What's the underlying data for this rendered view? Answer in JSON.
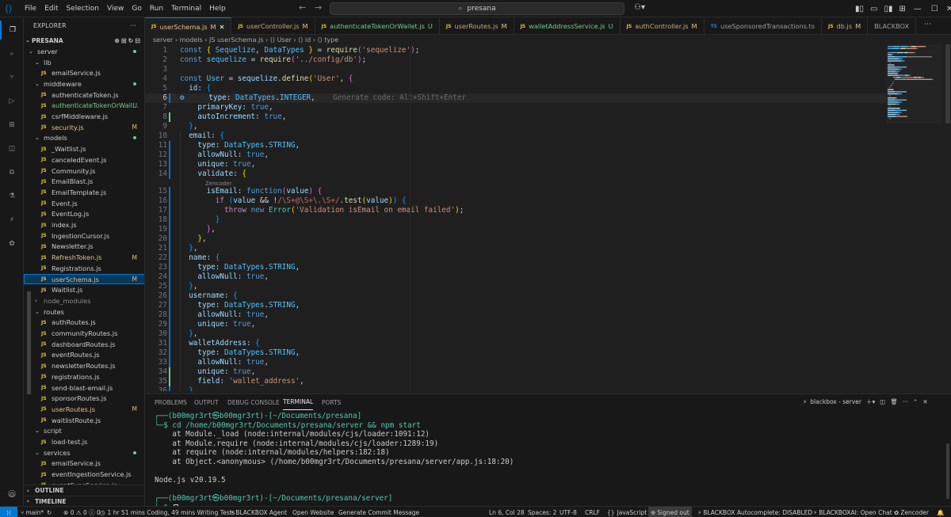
{
  "menu": [
    "File",
    "Edit",
    "Selection",
    "View",
    "Go",
    "Run",
    "Terminal",
    "Help"
  ],
  "search": "presana",
  "explorer": {
    "title": "EXPLORER",
    "root": "PRESANA",
    "rows": [
      {
        "label": "server",
        "type": "folder",
        "depth": 1,
        "status": "dot"
      },
      {
        "label": "lib",
        "type": "folder",
        "depth": 2,
        "status": ""
      },
      {
        "label": "emailService.js",
        "type": "file",
        "depth": 3,
        "status": ""
      },
      {
        "label": "middleware",
        "type": "folder",
        "depth": 2,
        "status": "dot"
      },
      {
        "label": "authenticateToken.js",
        "type": "file",
        "depth": 3,
        "status": ""
      },
      {
        "label": "authenticateTokenOrWall...",
        "type": "file",
        "depth": 3,
        "status": "U"
      },
      {
        "label": "csrfMiddleware.js",
        "type": "file",
        "depth": 3,
        "status": ""
      },
      {
        "label": "security.js",
        "type": "file",
        "depth": 3,
        "status": "M"
      },
      {
        "label": "models",
        "type": "folder",
        "depth": 2,
        "status": "dot"
      },
      {
        "label": "_Waitlist.js",
        "type": "file",
        "depth": 3,
        "status": ""
      },
      {
        "label": "canceledEvent.js",
        "type": "file",
        "depth": 3,
        "status": ""
      },
      {
        "label": "Community.js",
        "type": "file",
        "depth": 3,
        "status": ""
      },
      {
        "label": "EmailBlast.js",
        "type": "file",
        "depth": 3,
        "status": ""
      },
      {
        "label": "EmailTemplate.js",
        "type": "file",
        "depth": 3,
        "status": ""
      },
      {
        "label": "Event.js",
        "type": "file",
        "depth": 3,
        "status": ""
      },
      {
        "label": "EventLog.js",
        "type": "file",
        "depth": 3,
        "status": ""
      },
      {
        "label": "index.js",
        "type": "file",
        "depth": 3,
        "status": ""
      },
      {
        "label": "IngestionCursor.js",
        "type": "file",
        "depth": 3,
        "status": ""
      },
      {
        "label": "Newsletter.js",
        "type": "file",
        "depth": 3,
        "status": ""
      },
      {
        "label": "RefreshToken.js",
        "type": "file",
        "depth": 3,
        "status": "M"
      },
      {
        "label": "Registrations.js",
        "type": "file",
        "depth": 3,
        "status": ""
      },
      {
        "label": "userSchema.js",
        "type": "file",
        "depth": 3,
        "status": "M",
        "selected": true
      },
      {
        "label": "Waitlist.js",
        "type": "file",
        "depth": 3,
        "status": ""
      },
      {
        "label": "node_modules",
        "type": "folder-closed",
        "depth": 2,
        "status": ""
      },
      {
        "label": "routes",
        "type": "folder",
        "depth": 2,
        "status": ""
      },
      {
        "label": "authRoutes.js",
        "type": "file",
        "depth": 3,
        "status": ""
      },
      {
        "label": "communityRoutes.js",
        "type": "file",
        "depth": 3,
        "status": ""
      },
      {
        "label": "dashboardRoutes.js",
        "type": "file",
        "depth": 3,
        "status": ""
      },
      {
        "label": "eventRoutes.js",
        "type": "file",
        "depth": 3,
        "status": ""
      },
      {
        "label": "newsletterRoutes.js",
        "type": "file",
        "depth": 3,
        "status": ""
      },
      {
        "label": "registrations.js",
        "type": "file",
        "depth": 3,
        "status": ""
      },
      {
        "label": "send-blast-email.js",
        "type": "file",
        "depth": 3,
        "status": ""
      },
      {
        "label": "sponsorRoutes.js",
        "type": "file",
        "depth": 3,
        "status": ""
      },
      {
        "label": "userRoutes.js",
        "type": "file",
        "depth": 3,
        "status": "M"
      },
      {
        "label": "waitlistRoute.js",
        "type": "file",
        "depth": 3,
        "status": ""
      },
      {
        "label": "script",
        "type": "folder",
        "depth": 2,
        "status": ""
      },
      {
        "label": "load-test.js",
        "type": "file",
        "depth": 3,
        "status": ""
      },
      {
        "label": "services",
        "type": "folder",
        "depth": 2,
        "status": "dot"
      },
      {
        "label": "emailService.js",
        "type": "file",
        "depth": 3,
        "status": ""
      },
      {
        "label": "eventIngestionService.js",
        "type": "file",
        "depth": 3,
        "status": ""
      },
      {
        "label": "eventSyncService.js",
        "type": "file",
        "depth": 3,
        "status": ""
      }
    ],
    "outline": "OUTLINE",
    "timeline": "TIMELINE"
  },
  "tabs": [
    {
      "label": "userSchema.js",
      "status": "M",
      "kind": "js",
      "active": true
    },
    {
      "label": "userController.js",
      "status": "M",
      "kind": "js"
    },
    {
      "label": "authenticateTokenOrWallet.js",
      "status": "U",
      "kind": "js"
    },
    {
      "label": "userRoutes.js",
      "status": "M",
      "kind": "js"
    },
    {
      "label": "walletAddressService.js",
      "status": "U",
      "kind": "js"
    },
    {
      "label": "authController.js",
      "status": "M",
      "kind": "js"
    },
    {
      "label": "useSponsoredTransactions.ts",
      "status": "",
      "kind": "ts"
    },
    {
      "label": "db.js",
      "status": "M",
      "kind": "js"
    },
    {
      "label": "BLACKBOX",
      "status": "",
      "kind": "none"
    }
  ],
  "breadcrumb": "server › models › JS userSchema.js › ⟨⟩ User › ⟨⟩ id › ⟨⟩ type",
  "code_lines": [
    [
      [
        "const ",
        "k"
      ],
      [
        "{ ",
        "b1"
      ],
      [
        "Sequelize",
        "v"
      ],
      [
        ", ",
        "pun"
      ],
      [
        "DataTypes",
        "v"
      ],
      [
        " } ",
        "b1"
      ],
      [
        "= ",
        "pun"
      ],
      [
        "require",
        "f"
      ],
      [
        "(",
        "b2"
      ],
      [
        "'sequelize'",
        "s"
      ],
      [
        ")",
        "b2"
      ],
      [
        ";",
        "pun"
      ]
    ],
    [
      [
        "const ",
        "k"
      ],
      [
        "sequelize ",
        "v"
      ],
      [
        "= ",
        "pun"
      ],
      [
        "require",
        "f"
      ],
      [
        "(",
        "b2"
      ],
      [
        "'../config/db'",
        "s"
      ],
      [
        ")",
        "b2"
      ],
      [
        ";",
        "pun"
      ]
    ],
    [],
    [
      [
        "const ",
        "k"
      ],
      [
        "User ",
        "v"
      ],
      [
        "= ",
        "pun"
      ],
      [
        "sequelize",
        "p"
      ],
      [
        ".",
        "pun"
      ],
      [
        "define",
        "f"
      ],
      [
        "(",
        "b1"
      ],
      [
        "'User'",
        "s"
      ],
      [
        ", ",
        "pun"
      ],
      [
        "{",
        "b2"
      ]
    ],
    [
      [
        "  id: ",
        "p"
      ],
      [
        "{",
        "b3"
      ]
    ],
    [
      [
        "    type: ",
        "p"
      ],
      [
        "DataTypes",
        "v"
      ],
      [
        ".",
        "pun"
      ],
      [
        "INTEGER",
        "v"
      ],
      [
        ",",
        "pun"
      ],
      [
        "    Generate code: Alt+Shift+Enter",
        "ghost"
      ]
    ],
    [
      [
        "    primaryKey: ",
        "p"
      ],
      [
        "true",
        "k"
      ],
      [
        ",",
        "pun"
      ]
    ],
    [
      [
        "    autoIncrement: ",
        "p"
      ],
      [
        "true",
        "k"
      ],
      [
        ",",
        "pun"
      ]
    ],
    [
      [
        "  ",
        "pun"
      ],
      [
        "}",
        "b3"
      ],
      [
        ",",
        "pun"
      ]
    ],
    [
      [
        "  email: ",
        "p"
      ],
      [
        "{",
        "b3"
      ]
    ],
    [
      [
        "    type: ",
        "p"
      ],
      [
        "DataTypes",
        "v"
      ],
      [
        ".",
        "pun"
      ],
      [
        "STRING",
        "v"
      ],
      [
        ",",
        "pun"
      ]
    ],
    [
      [
        "    allowNull: ",
        "p"
      ],
      [
        "true",
        "k"
      ],
      [
        ",",
        "pun"
      ]
    ],
    [
      [
        "    unique: ",
        "p"
      ],
      [
        "true",
        "k"
      ],
      [
        ",",
        "pun"
      ]
    ],
    [
      [
        "    validate: ",
        "p"
      ],
      [
        "{",
        "b1"
      ]
    ],
    [
      [
        "      isEmail: ",
        "p"
      ],
      [
        "function",
        "k"
      ],
      [
        "(",
        "b2"
      ],
      [
        "value",
        "p"
      ],
      [
        ") ",
        "b2"
      ],
      [
        "{",
        "b2"
      ]
    ],
    [
      [
        "        ",
        "pun"
      ],
      [
        "if ",
        "c"
      ],
      [
        "(",
        "b3"
      ],
      [
        "value ",
        "p"
      ],
      [
        "&& ",
        "pun"
      ],
      [
        "!",
        "pun"
      ],
      [
        "/\\S+@\\S+\\.\\S+/",
        "re"
      ],
      [
        ".",
        "pun"
      ],
      [
        "test",
        "f"
      ],
      [
        "(",
        "b1"
      ],
      [
        "value",
        "p"
      ],
      [
        ")",
        "b1"
      ],
      [
        ") ",
        "b3"
      ],
      [
        "{",
        "b3"
      ]
    ],
    [
      [
        "          ",
        "pun"
      ],
      [
        "throw ",
        "c"
      ],
      [
        "new ",
        "k"
      ],
      [
        "Error",
        "t"
      ],
      [
        "(",
        "b1"
      ],
      [
        "'Validation isEmail on email failed'",
        "s"
      ],
      [
        ")",
        "b1"
      ],
      [
        ";",
        "pun"
      ]
    ],
    [
      [
        "        ",
        "pun"
      ],
      [
        "}",
        "b3"
      ]
    ],
    [
      [
        "      ",
        "pun"
      ],
      [
        "}",
        "b2"
      ],
      [
        ",",
        "pun"
      ]
    ],
    [
      [
        "    ",
        "pun"
      ],
      [
        "}",
        "b1"
      ],
      [
        ",",
        "pun"
      ]
    ],
    [
      [
        "  ",
        "pun"
      ],
      [
        "}",
        "b3"
      ],
      [
        ",",
        "pun"
      ]
    ],
    [
      [
        "  name: ",
        "p"
      ],
      [
        "{",
        "b3"
      ]
    ],
    [
      [
        "    type: ",
        "p"
      ],
      [
        "DataTypes",
        "v"
      ],
      [
        ".",
        "pun"
      ],
      [
        "STRING",
        "v"
      ],
      [
        ",",
        "pun"
      ]
    ],
    [
      [
        "    allowNull: ",
        "p"
      ],
      [
        "true",
        "k"
      ],
      [
        ",",
        "pun"
      ]
    ],
    [
      [
        "  ",
        "pun"
      ],
      [
        "}",
        "b3"
      ],
      [
        ",",
        "pun"
      ]
    ],
    [
      [
        "  username: ",
        "p"
      ],
      [
        "{",
        "b3"
      ]
    ],
    [
      [
        "    type: ",
        "p"
      ],
      [
        "DataTypes",
        "v"
      ],
      [
        ".",
        "pun"
      ],
      [
        "STRING",
        "v"
      ],
      [
        ",",
        "pun"
      ]
    ],
    [
      [
        "    allowNull: ",
        "p"
      ],
      [
        "true",
        "k"
      ],
      [
        ",",
        "pun"
      ]
    ],
    [
      [
        "    unique: ",
        "p"
      ],
      [
        "true",
        "k"
      ],
      [
        ",",
        "pun"
      ]
    ],
    [
      [
        "  ",
        "pun"
      ],
      [
        "}",
        "b3"
      ],
      [
        ",",
        "pun"
      ]
    ],
    [
      [
        "  walletAddress: ",
        "p"
      ],
      [
        "{",
        "b3"
      ]
    ],
    [
      [
        "    type: ",
        "p"
      ],
      [
        "DataTypes",
        "v"
      ],
      [
        ".",
        "pun"
      ],
      [
        "STRING",
        "v"
      ],
      [
        ",",
        "pun"
      ]
    ],
    [
      [
        "    allowNull: ",
        "p"
      ],
      [
        "true",
        "k"
      ],
      [
        ",",
        "pun"
      ]
    ],
    [
      [
        "    unique: ",
        "p"
      ],
      [
        "true",
        "k"
      ],
      [
        ",",
        "pun"
      ]
    ],
    [
      [
        "    field: ",
        "p"
      ],
      [
        "'wallet_address'",
        "s"
      ],
      [
        ",",
        "pun"
      ]
    ],
    [
      [
        "  ",
        "pun"
      ],
      [
        "}",
        "b3"
      ],
      [
        ",",
        "pun"
      ]
    ]
  ],
  "codelens": "Zencoder",
  "panel": {
    "tabs": [
      "PROBLEMS",
      "OUTPUT",
      "DEBUG CONSOLE",
      "TERMINAL",
      "PORTS"
    ],
    "active": "TERMINAL",
    "terminal_name": "blackbox - server",
    "lines": [
      "┌──(b00mgr3rt㉿b00mgr3rt)-[~/Documents/presana]",
      "└─$ cd /home/b00mgr3rt/Documents/presana/server && npm start",
      "    at Module._load (node:internal/modules/cjs/loader:1091:12)",
      "    at Module.require (node:internal/modules/cjs/loader:1289:19)",
      "    at require (node:internal/modules/helpers:182:18)",
      "    at Object.<anonymous> (/home/b00mgr3rt/Documents/presana/server/app.js:18:20)",
      "",
      "Node.js v20.19.5",
      "",
      "┌──(b00mgr3rt㉿b00mgr3rt)-[~/Documents/presana/server]",
      "└─$ "
    ]
  },
  "status": {
    "branch": "main*",
    "errors": "0",
    "warnings": "0",
    "infos": "0",
    "time": "1 hr 51 mins Coding, 49 mins Writing Tests",
    "agent": "BLACKBOX Agent",
    "open_website": "Open Website",
    "commit": "Generate Commit Message",
    "position": "Ln 6, Col 28",
    "spaces": "Spaces: 2",
    "encoding": "UTF-8",
    "eol": "CRLF",
    "language": "JavaScript",
    "signed_out": "Signed out",
    "autocomplete": "BLACKBOX Autocomplete: DISABLED",
    "blackboxai": "BLACKBOXAI: Open Chat",
    "zencoder": "Zencoder"
  },
  "colors": {
    "accent": "#0078d4",
    "modified": "#e2c08d",
    "untracked": "#73c991"
  }
}
